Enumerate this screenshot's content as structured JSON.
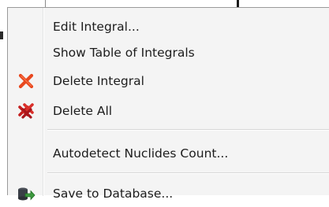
{
  "context_menu": {
    "items": [
      {
        "label": "Edit Integral...",
        "icon": null
      },
      {
        "label": "Show Table of Integrals",
        "icon": null
      },
      {
        "label": "Delete Integral",
        "icon": "delete-x-icon",
        "icon_color": "#e03a1a"
      },
      {
        "label": "Delete All",
        "icon": "delete-all-icon",
        "icon_color": "#c41e1e"
      },
      {
        "label": "Autodetect Nuclides Count...",
        "icon": null
      },
      {
        "label": "Save to Database...",
        "icon": "database-save-icon",
        "icon_color": "#2e7d32"
      }
    ]
  }
}
